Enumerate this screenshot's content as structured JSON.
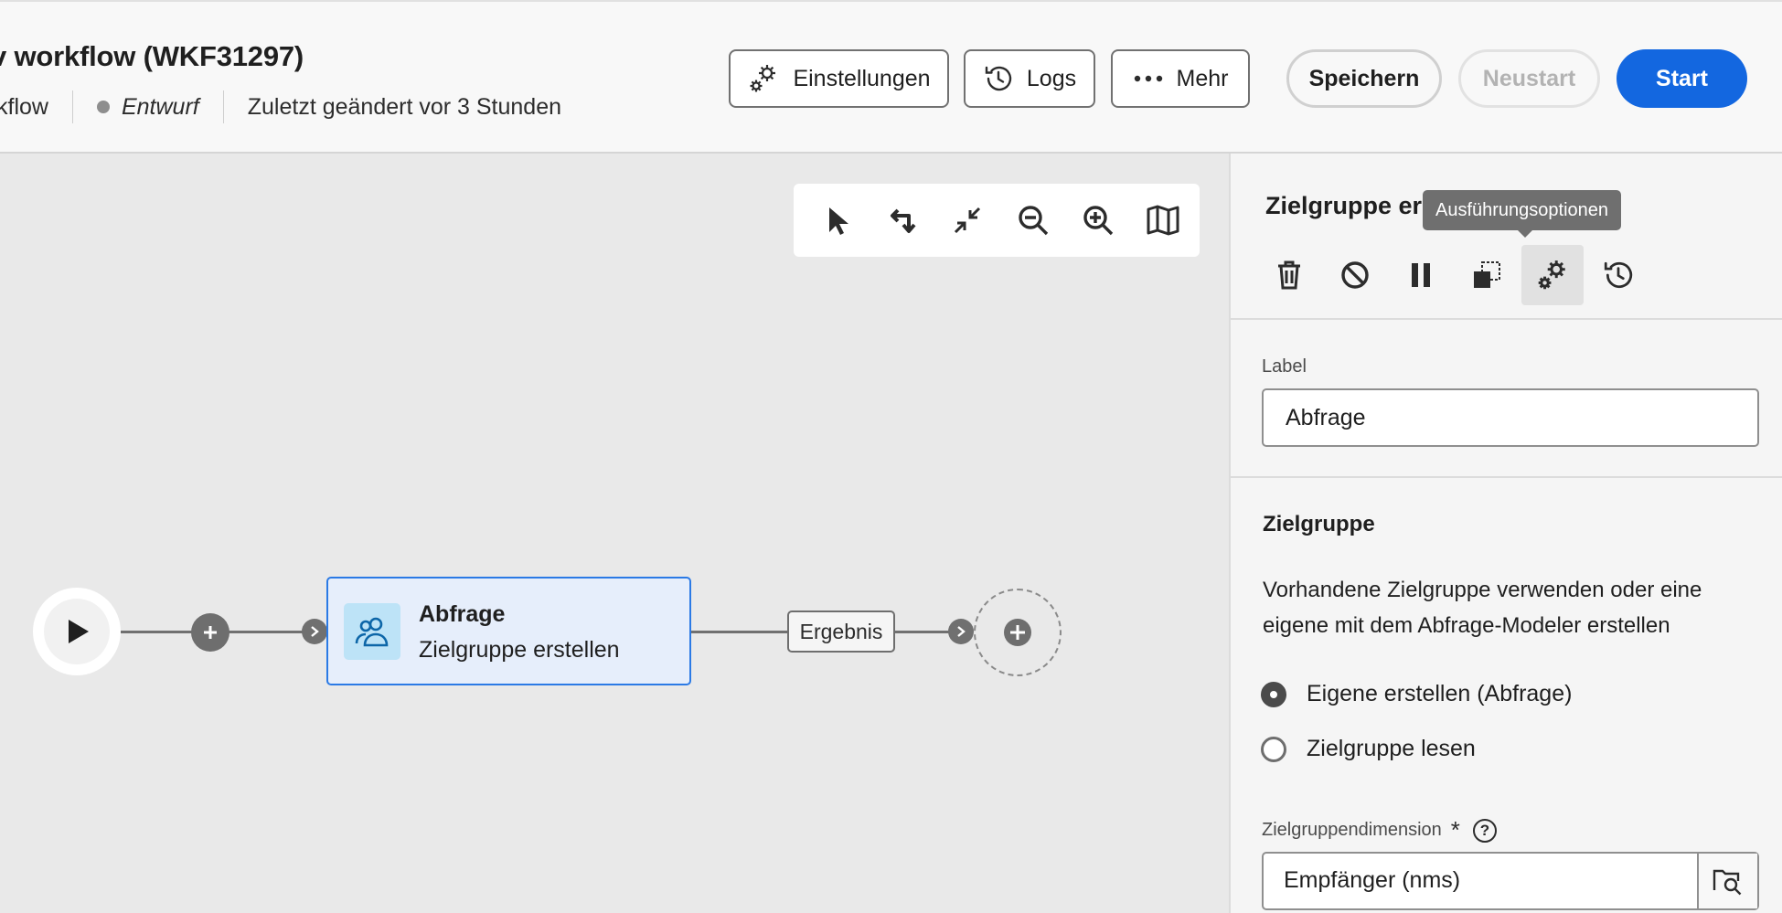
{
  "header": {
    "title": "v workflow (WKF31297)",
    "type_label": "kflow",
    "status": "Entwurf",
    "modified": "Zuletzt geändert vor 3 Stunden",
    "buttons": {
      "settings": "Einstellungen",
      "logs": "Logs",
      "more": "Mehr",
      "save": "Speichern",
      "restart": "Neustart",
      "start": "Start"
    }
  },
  "canvas": {
    "toolbar": [
      "select-icon",
      "undo-icon",
      "collapse-icon",
      "zoom-out-icon",
      "zoom-in-icon",
      "map-icon"
    ],
    "activity": {
      "title": "Abfrage",
      "subtitle": "Zielgruppe erstellen"
    },
    "result_tag": "Ergebnis"
  },
  "panel": {
    "title": "Zielgruppe er",
    "tooltip": "Ausführungsoptionen",
    "label_field": {
      "label": "Label",
      "value": "Abfrage"
    },
    "section": {
      "title": "Zielgruppe",
      "description": "Vorhandene Zielgruppe verwenden oder eine eigene mit dem Abfrage-Modeler erstellen",
      "options": [
        {
          "label": "Eigene erstellen (Abfrage)",
          "checked": true
        },
        {
          "label": "Zielgruppe lesen",
          "checked": false
        }
      ],
      "dimension": {
        "label": "Zielgruppendimension",
        "required_mark": "*",
        "help": "?",
        "value": "Empfänger (nms)"
      }
    }
  },
  "colors": {
    "accent": "#1367e0",
    "activity_border": "#2b7ae5",
    "activity_bg": "#e6eefb"
  }
}
